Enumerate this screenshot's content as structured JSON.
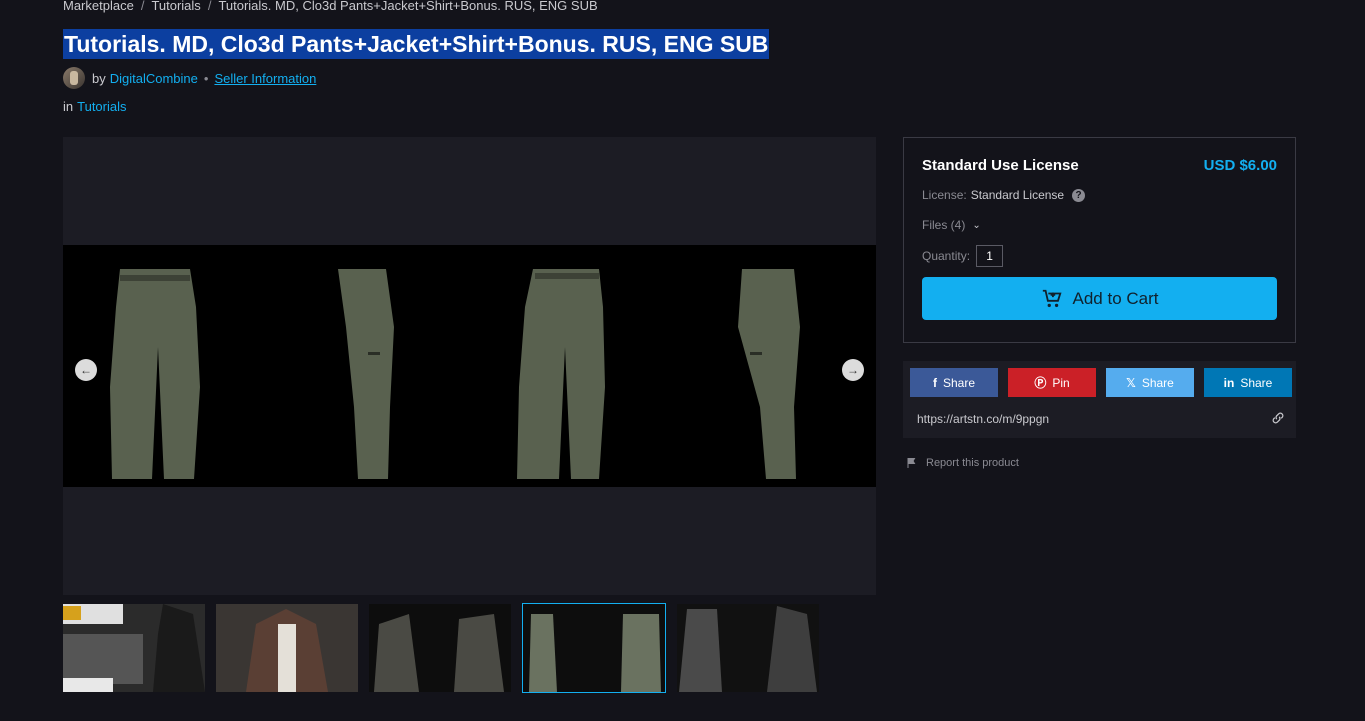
{
  "breadcrumb": {
    "items": [
      "Marketplace",
      "Tutorials",
      "Tutorials. MD, Clo3d Pants+Jacket+Shirt+Bonus. RUS, ENG SUB"
    ],
    "separator": "/"
  },
  "product": {
    "title": "Tutorials. MD, Clo3d Pants+Jacket+Shirt+Bonus. RUS, ENG SUB",
    "by_label": "by",
    "seller_name": "DigitalCombine",
    "seller_info_label": "Seller Information",
    "bullet": "•",
    "in_label": "in",
    "category": "Tutorials"
  },
  "viewer": {
    "prev_icon": "arrow-left-icon",
    "next_icon": "arrow-right-icon",
    "thumb_count": 5,
    "active_thumb": 4
  },
  "license": {
    "title": "Standard Use License",
    "price": "USD $6.00",
    "license_label": "License:",
    "license_value": "Standard License",
    "files_label": "Files (4)",
    "quantity_label": "Quantity:",
    "quantity_value": "1",
    "add_to_cart_label": "Add to Cart"
  },
  "share": {
    "facebook_label": "Share",
    "pinterest_label": "Pin",
    "x_label": "Share",
    "linkedin_label": "Share",
    "url": "https://artstn.co/m/9ppgn"
  },
  "report_label": "Report this product",
  "colors": {
    "accent": "#13aff0",
    "facebook": "#3b5998",
    "pinterest": "#cb2027",
    "x": "#55acee",
    "linkedin": "#0077b5",
    "background": "#13131a"
  }
}
